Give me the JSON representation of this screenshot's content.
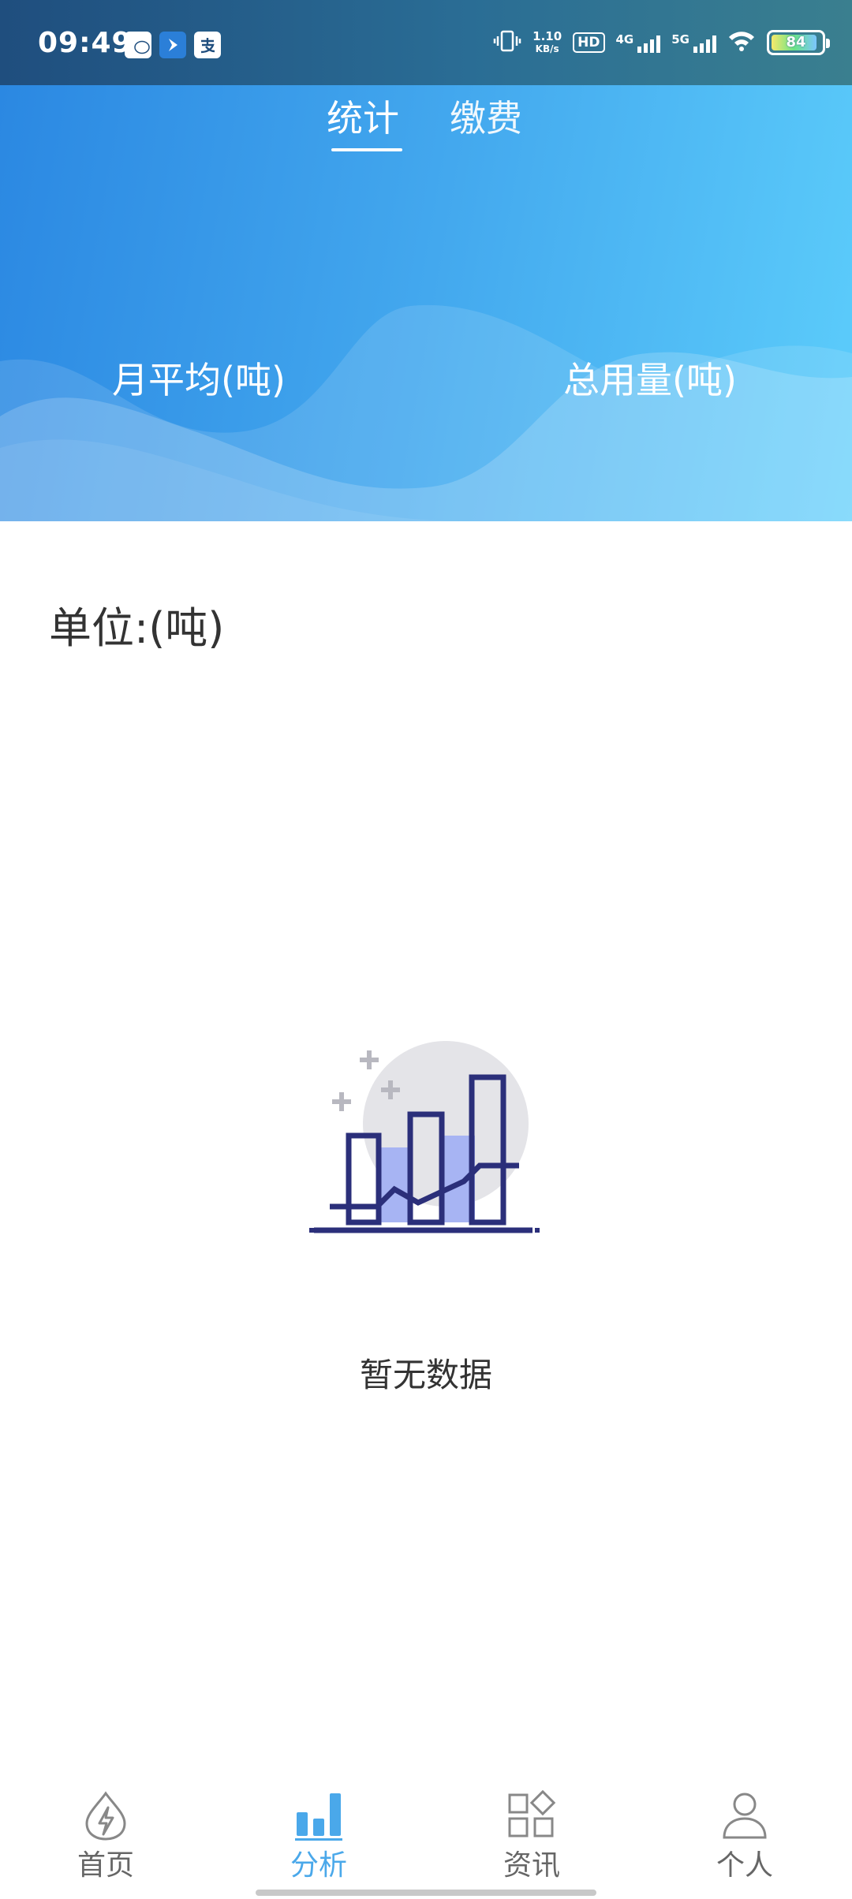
{
  "status_bar": {
    "time": "09:49",
    "net_speed_value": "1.10",
    "net_speed_unit": "KB/s",
    "hd_label": "HD",
    "sim_label_1": "4G",
    "sim_label_2": "5G",
    "battery": "84",
    "app_icons": [
      "wechat-icon",
      "maps-icon",
      "alipay-icon"
    ]
  },
  "tabs": [
    {
      "label": "统计",
      "active": true
    },
    {
      "label": "缴费",
      "active": false
    }
  ],
  "stats": {
    "monthly_avg_label": "月平均(吨)",
    "total_usage_label": "总用量(吨)"
  },
  "unit_label": "单位:(吨)",
  "empty_state": {
    "text": "暂无数据",
    "icon": "chart-empty-illustration"
  },
  "bottom_nav": [
    {
      "label": "首页",
      "icon": "drop-bolt-icon",
      "active": false
    },
    {
      "label": "分析",
      "icon": "bar-chart-icon",
      "active": true
    },
    {
      "label": "资讯",
      "icon": "grid-diamond-icon",
      "active": false
    },
    {
      "label": "个人",
      "icon": "person-icon",
      "active": false
    }
  ],
  "colors": {
    "accent": "#4aa8ea",
    "hero_start": "#2b88e2",
    "hero_end": "#5ccdfb"
  }
}
